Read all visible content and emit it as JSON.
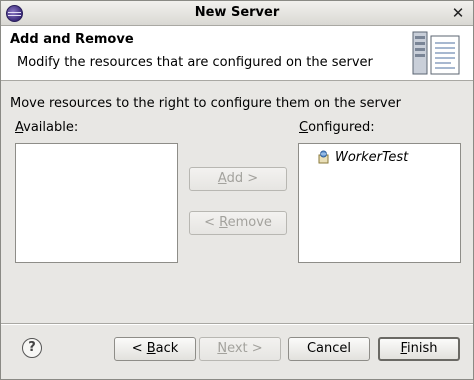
{
  "window": {
    "title": "New Server",
    "close_glyph": "✕"
  },
  "banner": {
    "title": "Add and Remove",
    "description": "Modify the resources that are configured on the server",
    "graphic_icon": "server-wizard-icon"
  },
  "instruction": "Move resources to the right to configure them on the server",
  "available": {
    "label_prefix": "",
    "label_mnemonic": "A",
    "label_rest": "vailable:",
    "items": []
  },
  "configured": {
    "label_prefix": "",
    "label_mnemonic": "C",
    "label_rest": "onfigured:",
    "items": [
      {
        "label": "WorkerTest",
        "icon": "web-module-icon"
      }
    ]
  },
  "buttons": {
    "add": {
      "before": "",
      "mnemonic": "A",
      "after": "dd >",
      "enabled": false
    },
    "remove": {
      "before": "< ",
      "mnemonic": "R",
      "after": "emove",
      "enabled": false
    },
    "back": {
      "before": "< ",
      "mnemonic": "B",
      "after": "ack",
      "enabled": true
    },
    "next": {
      "before": "",
      "mnemonic": "N",
      "after": "ext >",
      "enabled": false
    },
    "cancel": {
      "label": "Cancel",
      "enabled": true
    },
    "finish": {
      "before": "",
      "mnemonic": "F",
      "after": "inish",
      "enabled": true
    }
  },
  "help": {
    "glyph": "?"
  }
}
